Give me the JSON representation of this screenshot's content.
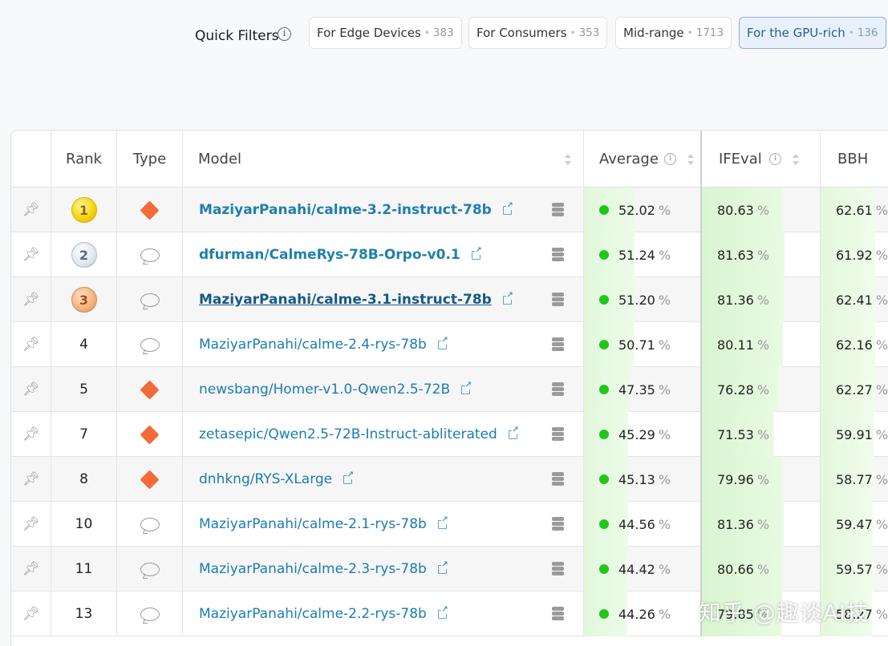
{
  "quick_filters": {
    "label": "Quick Filters",
    "chips": [
      {
        "label": "For Edge Devices",
        "count": "383",
        "active": false
      },
      {
        "label": "For Consumers",
        "count": "353",
        "active": false
      },
      {
        "label": "Mid-range",
        "count": "1713",
        "active": false
      },
      {
        "label": "For the GPU-rich",
        "count": "136",
        "active": true
      }
    ]
  },
  "columns": {
    "rank": "Rank",
    "type": "Type",
    "model": "Model",
    "average": "Average",
    "ifeval": "IFEval",
    "bbh": "BBH"
  },
  "colors": {
    "diamond_type": "#f26b38",
    "status_dot": "#22c619",
    "link": "#1b7cb3",
    "bar_green": "#d8f5d0"
  },
  "rows": [
    {
      "rank": "1",
      "medal": "gold",
      "type": "diamond-icon",
      "model": "MaziyarPanahi/calme-3.2-instruct-78b",
      "average": "52.02",
      "ifeval": "80.63",
      "bbh": "62.61",
      "bold": true
    },
    {
      "rank": "2",
      "medal": "silver",
      "type": "chat-bubble-icon",
      "model": "dfurman/CalmeRys-78B-Orpo-v0.1",
      "average": "51.24",
      "ifeval": "81.63",
      "bbh": "61.92",
      "bold": true
    },
    {
      "rank": "3",
      "medal": "bronze",
      "type": "chat-bubble-icon",
      "model": "MaziyarPanahi/calme-3.1-instruct-78b",
      "average": "51.20",
      "ifeval": "81.36",
      "bbh": "62.41",
      "bold": true,
      "underline": true
    },
    {
      "rank": "4",
      "type": "chat-bubble-icon",
      "model": "MaziyarPanahi/calme-2.4-rys-78b",
      "average": "50.71",
      "ifeval": "80.11",
      "bbh": "62.16"
    },
    {
      "rank": "5",
      "type": "diamond-icon",
      "model": "newsbang/Homer-v1.0-Qwen2.5-72B",
      "average": "47.35",
      "ifeval": "76.28",
      "bbh": "62.27"
    },
    {
      "rank": "7",
      "type": "diamond-icon",
      "model": "zetasepic/Qwen2.5-72B-Instruct-abliterated",
      "average": "45.29",
      "ifeval": "71.53",
      "bbh": "59.91"
    },
    {
      "rank": "8",
      "type": "diamond-icon",
      "model": "dnhkng/RYS-XLarge",
      "average": "45.13",
      "ifeval": "79.96",
      "bbh": "58.77"
    },
    {
      "rank": "10",
      "type": "chat-bubble-icon",
      "model": "MaziyarPanahi/calme-2.1-rys-78b",
      "average": "44.56",
      "ifeval": "81.36",
      "bbh": "59.47"
    },
    {
      "rank": "11",
      "type": "chat-bubble-icon",
      "model": "MaziyarPanahi/calme-2.3-rys-78b",
      "average": "44.42",
      "ifeval": "80.66",
      "bbh": "59.57"
    },
    {
      "rank": "13",
      "type": "chat-bubble-icon",
      "model": "MaziyarPanahi/calme-2.2-rys-78b",
      "average": "44.26",
      "ifeval": "79.85",
      "bbh": "58.27"
    }
  ],
  "unit": "%",
  "watermark": "知乎 @趣谈AI技"
}
